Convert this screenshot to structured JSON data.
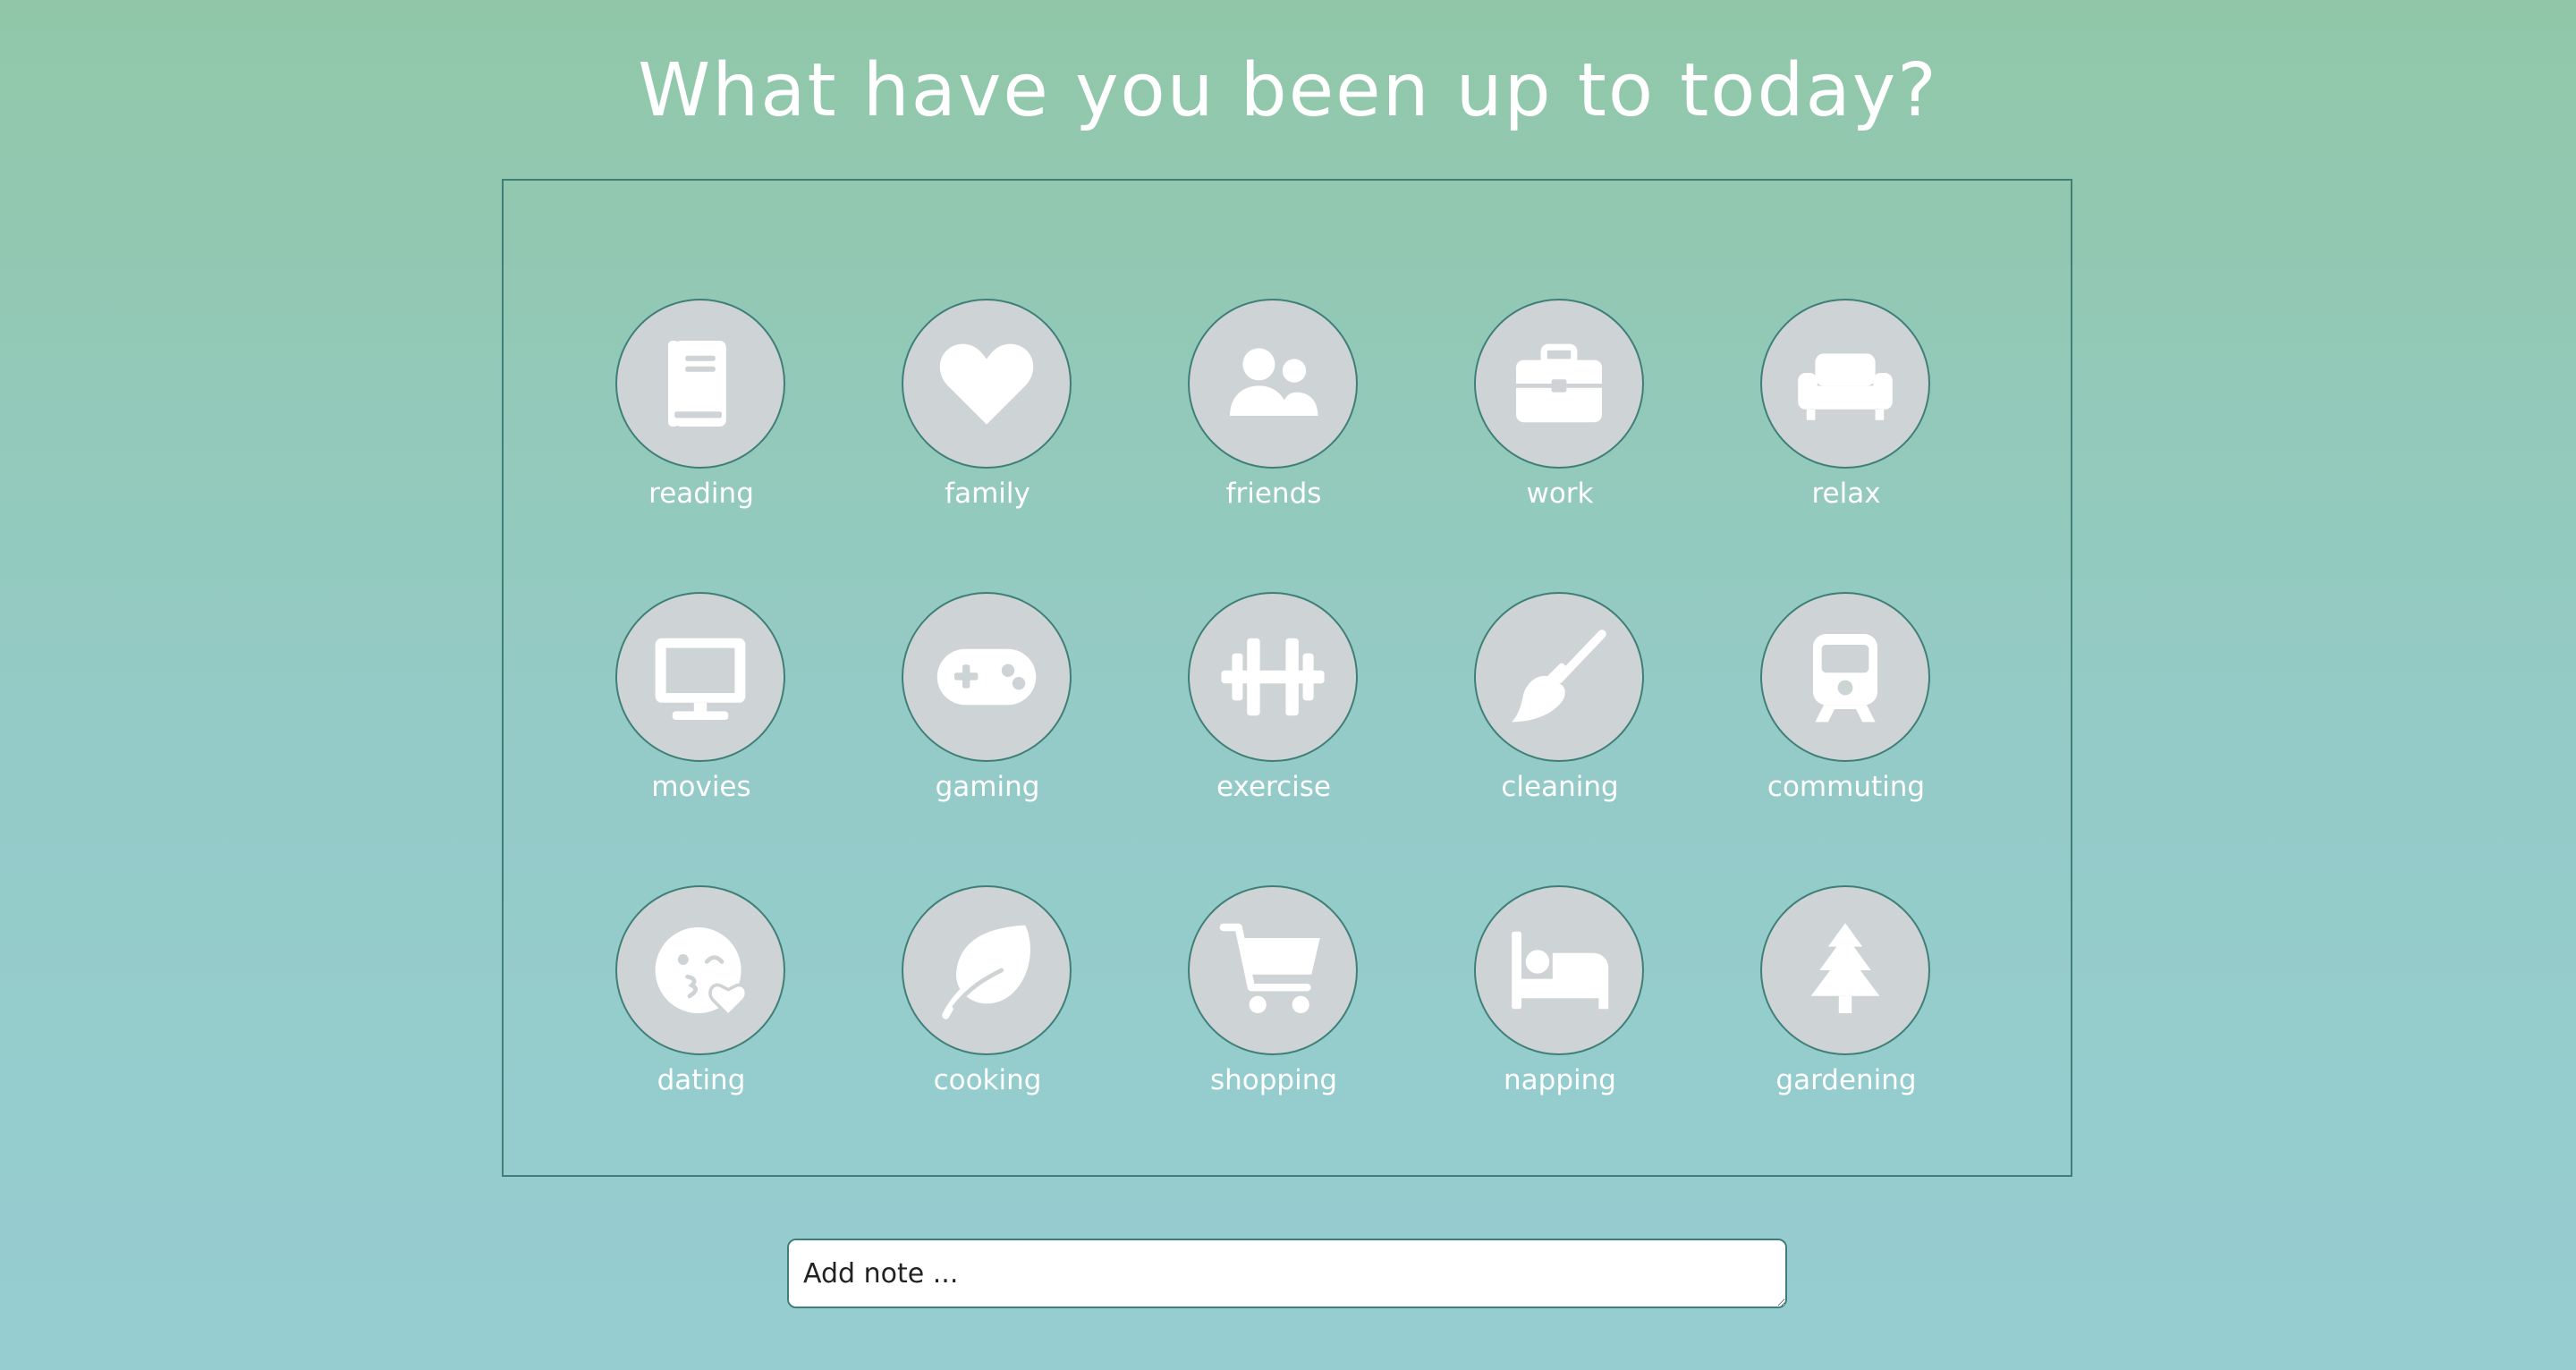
{
  "page": {
    "title": "What have you been up to today?"
  },
  "colors": {
    "background_top": "#91c7a8",
    "background_bottom": "#96cdd1",
    "panel_border": "#3f7f78",
    "circle_fill": "#ced4d5",
    "icon_fill": "#ffffff",
    "text": "#ffffff"
  },
  "activities": [
    {
      "label": "reading",
      "icon": "book-icon"
    },
    {
      "label": "family",
      "icon": "heart-icon"
    },
    {
      "label": "friends",
      "icon": "users-icon"
    },
    {
      "label": "work",
      "icon": "briefcase-icon"
    },
    {
      "label": "relax",
      "icon": "couch-icon"
    },
    {
      "label": "movies",
      "icon": "tv-icon"
    },
    {
      "label": "gaming",
      "icon": "gamepad-icon"
    },
    {
      "label": "exercise",
      "icon": "dumbbell-icon"
    },
    {
      "label": "cleaning",
      "icon": "broom-icon"
    },
    {
      "label": "commuting",
      "icon": "train-icon"
    },
    {
      "label": "dating",
      "icon": "kiss-wink-heart-icon"
    },
    {
      "label": "cooking",
      "icon": "leaf-icon"
    },
    {
      "label": "shopping",
      "icon": "shopping-cart-icon"
    },
    {
      "label": "napping",
      "icon": "bed-icon"
    },
    {
      "label": "gardening",
      "icon": "tree-icon"
    }
  ],
  "note": {
    "placeholder": "Add note ..."
  }
}
